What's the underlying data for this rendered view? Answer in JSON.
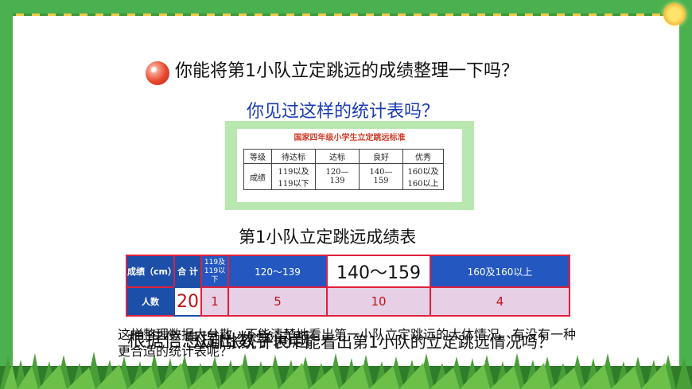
{
  "question": "你能将第1小队立定跳远的成绩整理一下吗？",
  "subtitle": "你见过这样的统计表吗？",
  "standards": {
    "title": "国家四年级小学生立定跳远标准",
    "headers": [
      "等级",
      "待达标",
      "达标",
      "良好",
      "优秀"
    ],
    "row_label": "成绩",
    "values": [
      "119以及119以下",
      "120—139",
      "140—159",
      "160以及160以上"
    ]
  },
  "table_title": "第1小队立定跳远成绩表",
  "main_table": {
    "row1_label": "成绩（cm）",
    "total_label": "合 计",
    "ranges": [
      "119及119以下",
      "120～139",
      "140～159",
      "160及160以上"
    ],
    "row2_label": "人数",
    "total_value": "20",
    "counts": [
      "1",
      "5",
      "10",
      "4"
    ]
  },
  "overlay_texts": [
    "这样整理数据太分散，不能清楚地看出第一小队立定跳远的大体情况。有没有一种更合适的统计表呢？",
    "根据信息提出数学问题",
    "从哪张统计表中能看出第1小队的立定跳远情况吗？"
  ],
  "colors": {
    "header_blue": "#1c4fa8",
    "border_red": "#e0203c",
    "pink": "#e7cfe6",
    "frame_green": "#4bb04e"
  }
}
